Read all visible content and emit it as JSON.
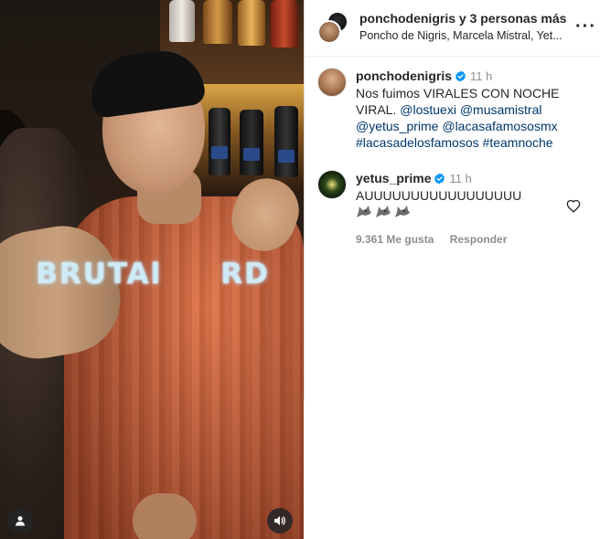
{
  "header": {
    "username": "ponchodenigris",
    "collab_suffix": "y 3 personas más",
    "collaborators": "Poncho de Nigris, Marcela Mistral, Yet...",
    "more_label": "···"
  },
  "media": {
    "overlay_text": "BRUTAl     RD"
  },
  "caption": {
    "username": "ponchodenigris",
    "time": "11 h",
    "text": "Nos fuimos VIRALES CON NOCHE VIRAL.",
    "mentions": [
      "@lostuexi",
      "@musamistral",
      "@yetus_prime",
      "@lacasafamososmx",
      "#lacasadelosfamosos",
      "#teamnoche"
    ]
  },
  "comment": {
    "username": "yetus_prime",
    "time": "11 h",
    "text": "AUUUUUUUUUUUUUUUUU",
    "emoji_count": 3,
    "likes": "9.361 Me gusta",
    "reply_label": "Responder"
  },
  "colors": {
    "link": "#00376b",
    "verified": "#0095f6",
    "muted": "#8e8e8e"
  },
  "icons": [
    "person-tag-icon",
    "sound-icon",
    "verified-icon",
    "heart-icon",
    "wolf-emoji-icon",
    "more-icon"
  ]
}
